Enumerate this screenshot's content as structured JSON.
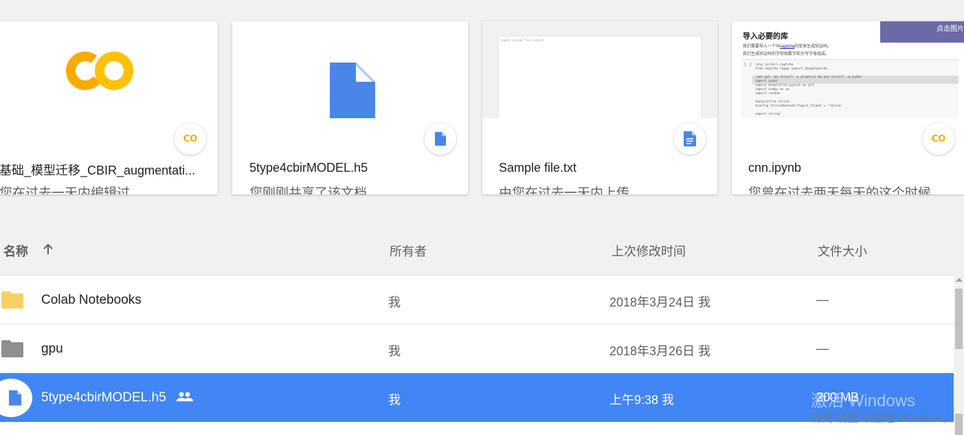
{
  "cards": [
    {
      "title": "基础_模型迁移_CBIR_augmentati...",
      "subtitle": "您在过去一天内编辑过",
      "icon": "colab-icon"
    },
    {
      "title": "5type4cbirMODEL.h5",
      "subtitle": "您刚刚共享了该文档",
      "icon": "file-icon"
    },
    {
      "title": "Sample file.txt",
      "subtitle": "由您在过去一天内上传",
      "icon": "doc-icon",
      "preview_text": "sample upload file content"
    },
    {
      "title": "cnn.ipynb",
      "subtitle": "您曾在过去两天每天的这个时候...",
      "icon": "colab-icon",
      "preview": {
        "banner": "点击图片上方的“打开”",
        "heading": "导入必要的库",
        "line1_prefix": "我们需要导入一个叫",
        "line1_link": "captcha",
        "line1_suffix": "的库来生成验证码。",
        "line2": "我们生成验证码的字符由数字和大写字母组成。",
        "brackets": "[ ]",
        "code": [
          "!pip install captcha",
          "from captcha.image import ImageCaptcha",
          "",
          "!apt-get -qq install -y graphviz && pip install -q pydot",
          "import pydot",
          "import matplotlib.pyplot as plt",
          "import numpy as np",
          "import random",
          "",
          "%matplotlib inline",
          "%config InlineBackend.figure_format = 'retina'",
          "",
          "import string"
        ]
      }
    }
  ],
  "colab_logo": "CO",
  "list_header": {
    "name": "名称",
    "sort_icon": "arrow-up-icon",
    "owner": "所有者",
    "modified": "上次修改时间",
    "size": "文件大小"
  },
  "rows": [
    {
      "name": "Colab Notebooks",
      "owner": "我",
      "modified": "2018年3月24日 我",
      "size": "—",
      "icon": "folder-icon",
      "icon_color": "#fbd063",
      "selected": false
    },
    {
      "name": "gpu",
      "owner": "我",
      "modified": "2018年3月26日 我",
      "size": "—",
      "icon": "folder-icon",
      "icon_color": "#8f8f8f",
      "selected": false
    },
    {
      "name": "5type4cbirMODEL.h5",
      "owner": "我",
      "modified": "上午9:38 我",
      "size": "200 MB",
      "icon": "file-icon",
      "shared_icon": "people-icon",
      "selected": true
    }
  ],
  "watermark": {
    "line1": "激活 Windows",
    "line2": "转到“设置”以激活 Windows。"
  },
  "colors": {
    "selection": "#4285f4",
    "file_blue": "#4a86e8",
    "colab_orange": "#f9ab00",
    "colab_yellow": "#ffd33a"
  }
}
